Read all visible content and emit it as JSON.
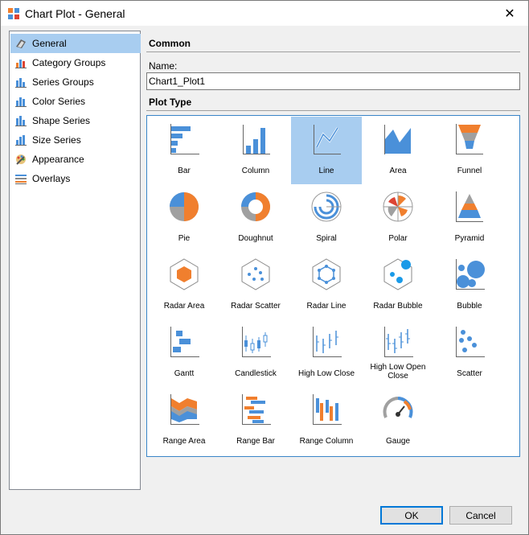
{
  "window": {
    "title": "Chart Plot - General",
    "close_glyph": "✕"
  },
  "sidebar": {
    "items": [
      {
        "label": "General",
        "icon": "general-icon",
        "selected": true
      },
      {
        "label": "Category Groups",
        "icon": "category-groups-icon"
      },
      {
        "label": "Series Groups",
        "icon": "series-groups-icon"
      },
      {
        "label": "Color Series",
        "icon": "color-series-icon"
      },
      {
        "label": "Shape Series",
        "icon": "shape-series-icon"
      },
      {
        "label": "Size Series",
        "icon": "size-series-icon"
      },
      {
        "label": "Appearance",
        "icon": "appearance-icon"
      },
      {
        "label": "Overlays",
        "icon": "overlays-icon"
      }
    ]
  },
  "common": {
    "header": "Common",
    "name_label": "Name:",
    "name_value": "Chart1_Plot1"
  },
  "plot_type": {
    "header": "Plot Type",
    "selected": "Line",
    "types": [
      "Bar",
      "Column",
      "Line",
      "Area",
      "Funnel",
      "Pie",
      "Doughnut",
      "Spiral",
      "Polar",
      "Pyramid",
      "Radar Area",
      "Radar Scatter",
      "Radar Line",
      "Radar Bubble",
      "Bubble",
      "Gantt",
      "Candlestick",
      "High Low Close",
      "High Low Open Close",
      "Scatter",
      "Range Area",
      "Range Bar",
      "Range Column",
      "Gauge"
    ]
  },
  "buttons": {
    "ok": "OK",
    "cancel": "Cancel"
  },
  "colors": {
    "accent": "#3a85c8",
    "selection": "#a8cdf0",
    "chart_blue": "#4a90d9",
    "chart_orange": "#f07f2e",
    "chart_gray": "#a0a0a0"
  }
}
